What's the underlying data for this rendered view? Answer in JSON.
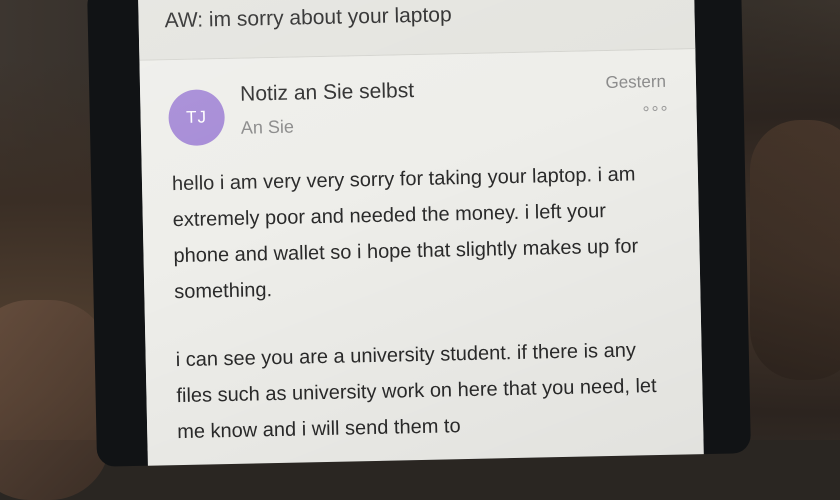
{
  "subject": "AW: im sorry about your laptop",
  "message": {
    "avatar_initials": "TJ",
    "sender": "Notiz an Sie selbst",
    "recipient": "An Sie",
    "date": "Gestern",
    "more_icon": "ellipsis-icon",
    "paragraphs": [
      "hello i am very very sorry for taking your laptop. i am extremely poor and needed the money. i left your phone and wallet so i hope that slightly makes up for something.",
      "i can see you are a university student. if there is any files such as university work on here that you need, let me know and i will send them to"
    ]
  },
  "colors": {
    "avatar": "#a58ad6",
    "screen_bg": "#eeeeea",
    "subject_bar_bg": "#e4e4df"
  }
}
